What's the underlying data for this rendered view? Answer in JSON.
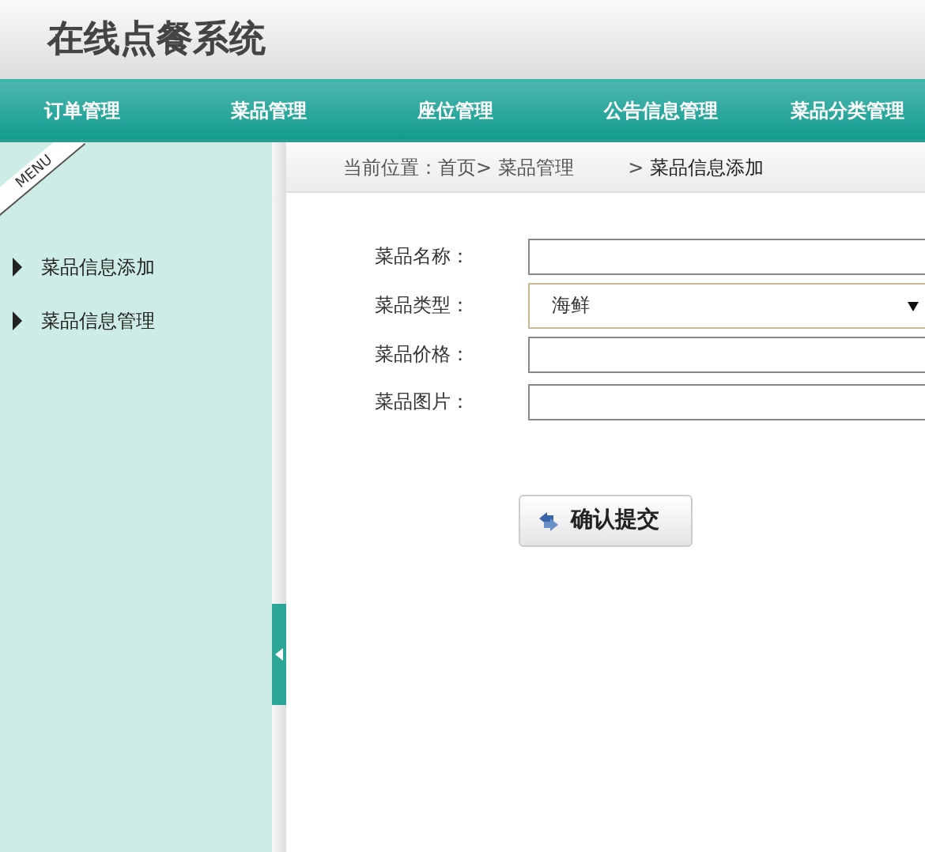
{
  "header": {
    "title": "在线点餐系统"
  },
  "nav": [
    {
      "label": "订单管理"
    },
    {
      "label": "菜品管理"
    },
    {
      "label": "座位管理"
    },
    {
      "label": "公告信息管理"
    },
    {
      "label": "菜品分类管理"
    }
  ],
  "sidebar": {
    "ribbon": "MENU",
    "items": [
      {
        "label": "菜品信息添加"
      },
      {
        "label": "菜品信息管理"
      }
    ]
  },
  "breadcrumb": [
    "当前位置：首页>",
    "菜品管理",
    ">",
    "菜品信息添加"
  ],
  "form": {
    "fields": [
      {
        "label": "菜品名称：",
        "kind": "text"
      },
      {
        "label": "菜品类型：",
        "kind": "select",
        "value": "海鲜"
      },
      {
        "label": "菜品价格：",
        "kind": "text"
      },
      {
        "label": "菜品图片：",
        "kind": "text"
      }
    ],
    "submit": "确认提交"
  }
}
